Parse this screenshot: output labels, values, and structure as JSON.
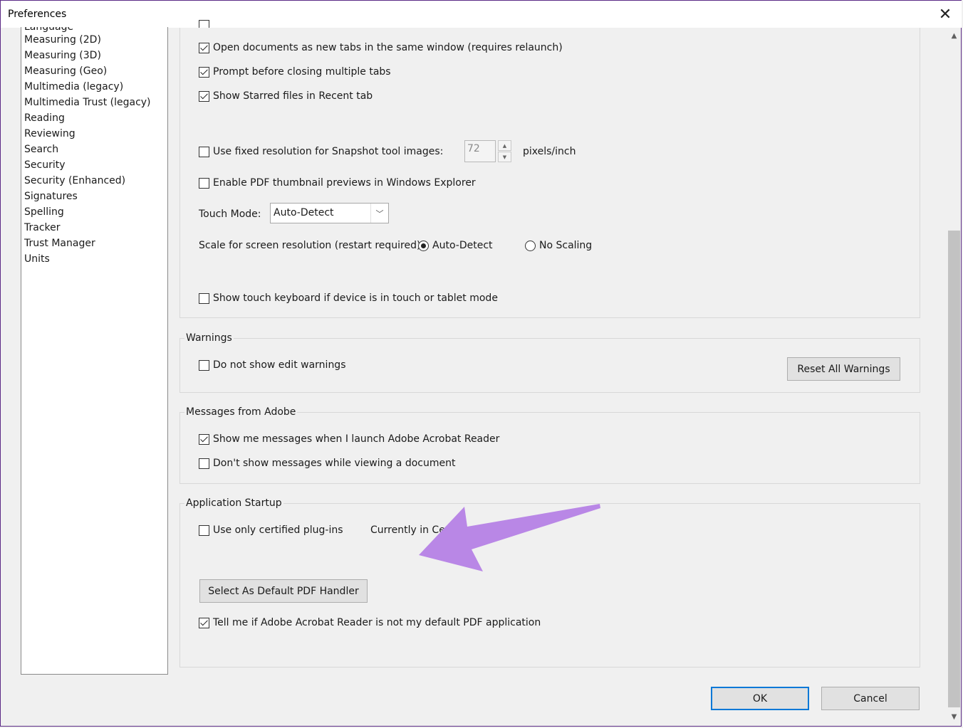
{
  "window": {
    "title": "Preferences",
    "close_glyph": "✕"
  },
  "sidebar": {
    "items": [
      {
        "label": "Language"
      },
      {
        "label": "Measuring (2D)"
      },
      {
        "label": "Measuring (3D)"
      },
      {
        "label": "Measuring (Geo)"
      },
      {
        "label": "Multimedia (legacy)"
      },
      {
        "label": "Multimedia Trust (legacy)"
      },
      {
        "label": "Reading"
      },
      {
        "label": "Reviewing"
      },
      {
        "label": "Search"
      },
      {
        "label": "Security"
      },
      {
        "label": "Security (Enhanced)"
      },
      {
        "label": "Signatures"
      },
      {
        "label": "Spelling"
      },
      {
        "label": "Tracker"
      },
      {
        "label": "Trust Manager"
      },
      {
        "label": "Units"
      }
    ]
  },
  "general": {
    "open_tabs": {
      "label": "Open documents as new tabs in the same window (requires relaunch)",
      "checked": true
    },
    "prompt_close": {
      "label": "Prompt before closing multiple tabs",
      "checked": true
    },
    "starred_recent": {
      "label": "Show Starred files in Recent tab",
      "checked": true
    },
    "snapshot_res": {
      "label": "Use fixed resolution for Snapshot tool images:",
      "checked": false,
      "value": "72",
      "unit": "pixels/inch"
    },
    "thumbnail_preview": {
      "label": "Enable PDF thumbnail previews in Windows Explorer",
      "checked": false
    },
    "touch_mode": {
      "label": "Touch Mode:",
      "value": "Auto-Detect"
    },
    "scale": {
      "label": "Scale for screen resolution (restart required):",
      "options": [
        "Auto-Detect",
        "No Scaling"
      ],
      "selected": "Auto-Detect"
    },
    "touch_keyboard": {
      "label": "Show touch keyboard if device is in touch or tablet mode",
      "checked": false
    }
  },
  "warnings": {
    "title": "Warnings",
    "no_edit_warnings": {
      "label": "Do not show edit warnings",
      "checked": false
    },
    "reset_button": "Reset All Warnings"
  },
  "messages": {
    "title": "Messages from Adobe",
    "show_on_launch": {
      "label": "Show me messages when I launch Adobe Acrobat Reader",
      "checked": true
    },
    "dont_show_viewing": {
      "label": "Don't show messages while viewing a document",
      "checked": false
    }
  },
  "startup": {
    "title": "Application Startup",
    "certified_plugins": {
      "label": "Use only certified plug-ins",
      "checked": false
    },
    "currently_in": "Currently in Cer",
    "default_handler_button": "Select As Default PDF Handler",
    "tell_me_default": {
      "label": "Tell me if Adobe Acrobat Reader is not my default PDF application",
      "checked": true
    }
  },
  "footer": {
    "ok": "OK",
    "cancel": "Cancel"
  },
  "annotation": {
    "arrow_color": "#b987e6"
  }
}
